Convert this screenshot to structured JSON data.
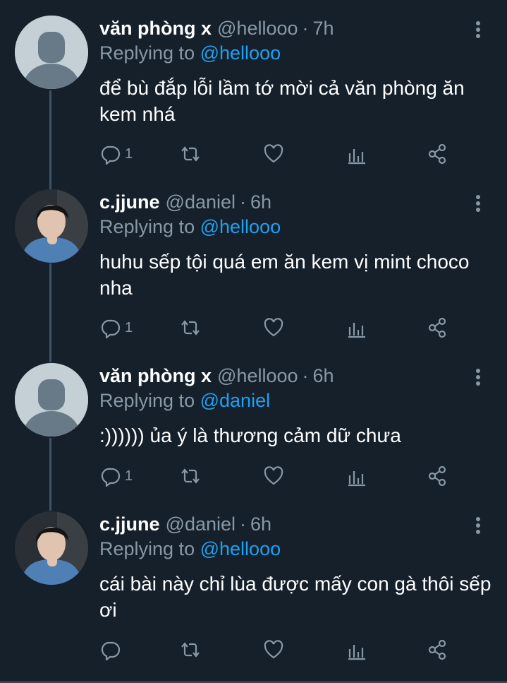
{
  "colors": {
    "background": "#15202b",
    "text": "#ffffff",
    "secondary": "#8899a6",
    "accent": "#1da1f2",
    "thread_line": "#3d5466"
  },
  "ui": {
    "replying_to_label": "Replying to",
    "dot": "·"
  },
  "tweets": [
    {
      "name": "văn phòng x",
      "handle": "@hellooo",
      "time": "7h",
      "reply_to": "@hellooo",
      "text": "để bù đắp lỗi lầm tớ mời cả văn phòng ăn kem nhá",
      "reply_count": "1",
      "avatar": "default-avatar"
    },
    {
      "name": "c.jjune",
      "handle": "@daniel",
      "time": "6h",
      "reply_to": "@hellooo",
      "text": "huhu sếp tội quá em ăn kem vị mint choco nha",
      "reply_count": "1",
      "avatar": "profile-photo"
    },
    {
      "name": "văn phòng x",
      "handle": "@hellooo",
      "time": "6h",
      "reply_to": "@daniel",
      "text": ":)))))) ủa ý là thương cảm dữ chưa",
      "reply_count": "1",
      "avatar": "default-avatar"
    },
    {
      "name": "c.jjune",
      "handle": "@daniel",
      "time": "6h",
      "reply_to": "@hellooo",
      "text": "cái bài này chỉ lùa được mấy con gà thôi sếp ơi",
      "reply_count": "",
      "avatar": "profile-photo"
    }
  ],
  "icons": {
    "reply": "reply-icon",
    "retweet": "retweet-icon",
    "like": "like-icon",
    "analytics": "analytics-icon",
    "share": "share-icon",
    "more": "more-vertical-icon"
  }
}
